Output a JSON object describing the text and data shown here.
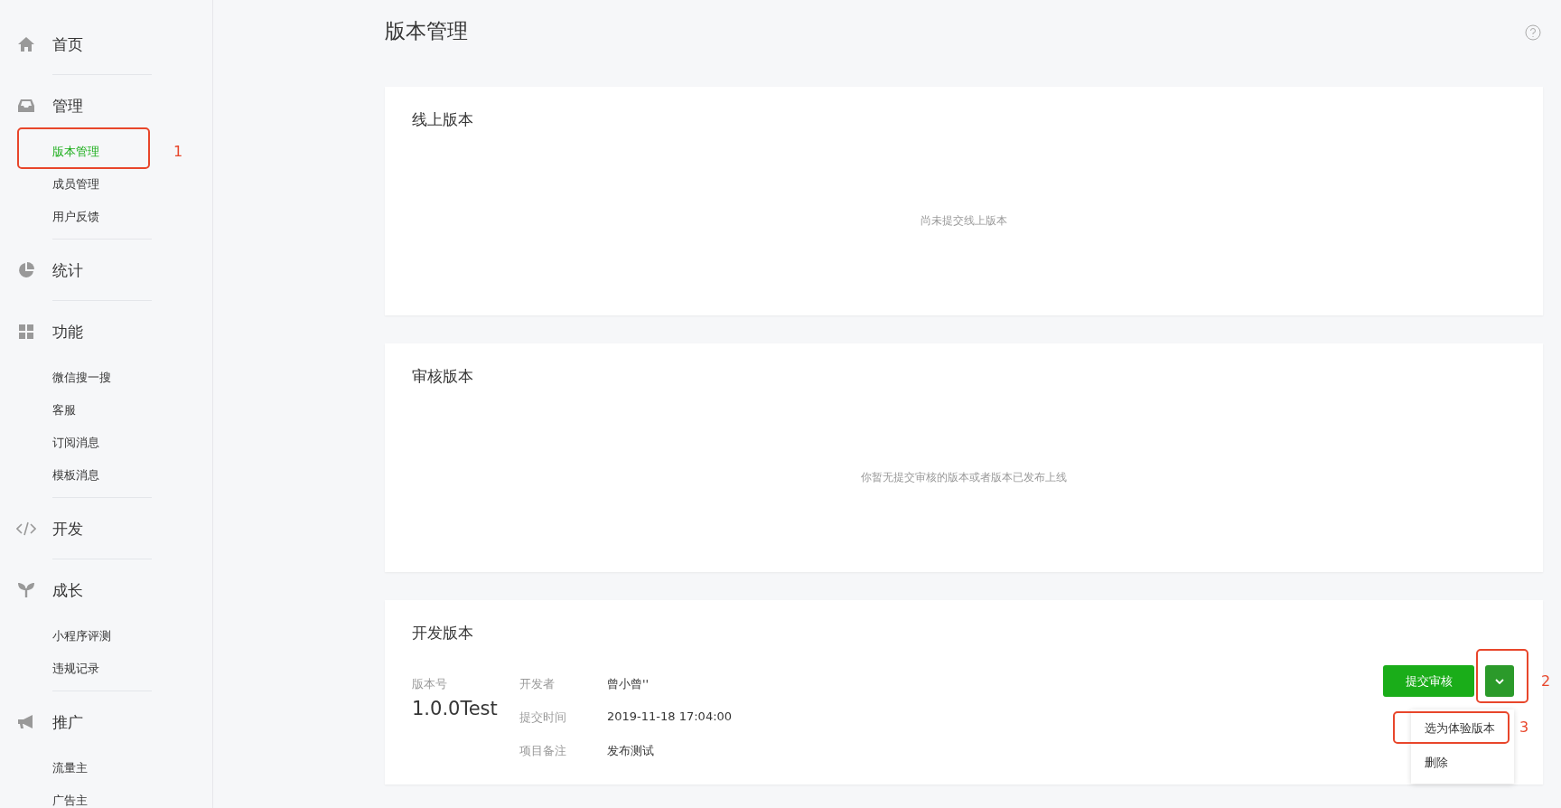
{
  "sidebar": {
    "groups": [
      {
        "label": "首页"
      },
      {
        "label": "管理",
        "items": [
          {
            "label": "版本管理",
            "selected": true,
            "annotation": "1"
          },
          {
            "label": "成员管理",
            "selected": false
          },
          {
            "label": "用户反馈",
            "selected": false
          }
        ]
      },
      {
        "label": "统计"
      },
      {
        "label": "功能",
        "items": [
          {
            "label": "微信搜一搜",
            "selected": false
          },
          {
            "label": "客服",
            "selected": false
          },
          {
            "label": "订阅消息",
            "selected": false
          },
          {
            "label": "模板消息",
            "selected": false
          }
        ]
      },
      {
        "label": "开发"
      },
      {
        "label": "成长",
        "items": [
          {
            "label": "小程序评测",
            "selected": false
          },
          {
            "label": "违规记录",
            "selected": false
          }
        ]
      },
      {
        "label": "推广",
        "items": [
          {
            "label": "流量主",
            "selected": false
          },
          {
            "label": "广告主",
            "selected": false
          }
        ]
      }
    ]
  },
  "main": {
    "title": "版本管理",
    "cards": [
      {
        "kind": "empty",
        "title": "线上版本",
        "message": "尚未提交线上版本"
      },
      {
        "kind": "empty",
        "title": "审核版本",
        "message": "你暂无提交审核的版本或者版本已发布上线"
      },
      {
        "kind": "version",
        "title": "开发版本",
        "version_label": "版本号",
        "version": "1.0.0Test",
        "fields": [
          {
            "label": "开发者",
            "value": "曾小曾''"
          },
          {
            "label": "提交时间",
            "value": "2019-11-18 17:04:00"
          },
          {
            "label": "项目备注",
            "value": "发布测试"
          }
        ],
        "primary_button": "提交审核",
        "dropdown": {
          "expanded": true,
          "annotation": "2",
          "menu": [
            {
              "label": "选为体验版本",
              "annotation": "3"
            },
            {
              "label": "删除"
            }
          ]
        }
      }
    ]
  }
}
